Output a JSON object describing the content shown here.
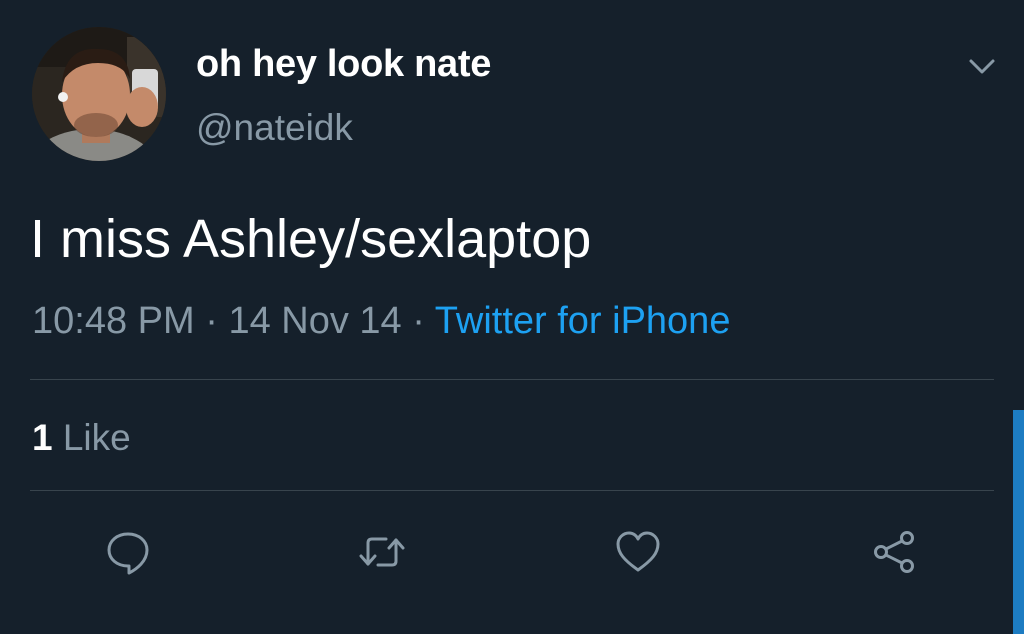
{
  "tweet": {
    "display_name": "oh hey look nate",
    "handle": "@nateidk",
    "text": "I miss Ashley/sexlaptop",
    "time": "10:48 PM",
    "separator": "·",
    "date": "14 Nov 14",
    "source": "Twitter for iPhone",
    "likes_count": "1",
    "likes_label": "Like"
  },
  "icons": {
    "caret": "chevron-down-icon",
    "reply": "reply-icon",
    "retweet": "retweet-icon",
    "like": "heart-icon",
    "share": "share-icon"
  },
  "colors": {
    "background": "#15202b",
    "primary_text": "#ffffff",
    "secondary_text": "#8899a6",
    "accent": "#1da1f2",
    "divider": "#38444d"
  }
}
